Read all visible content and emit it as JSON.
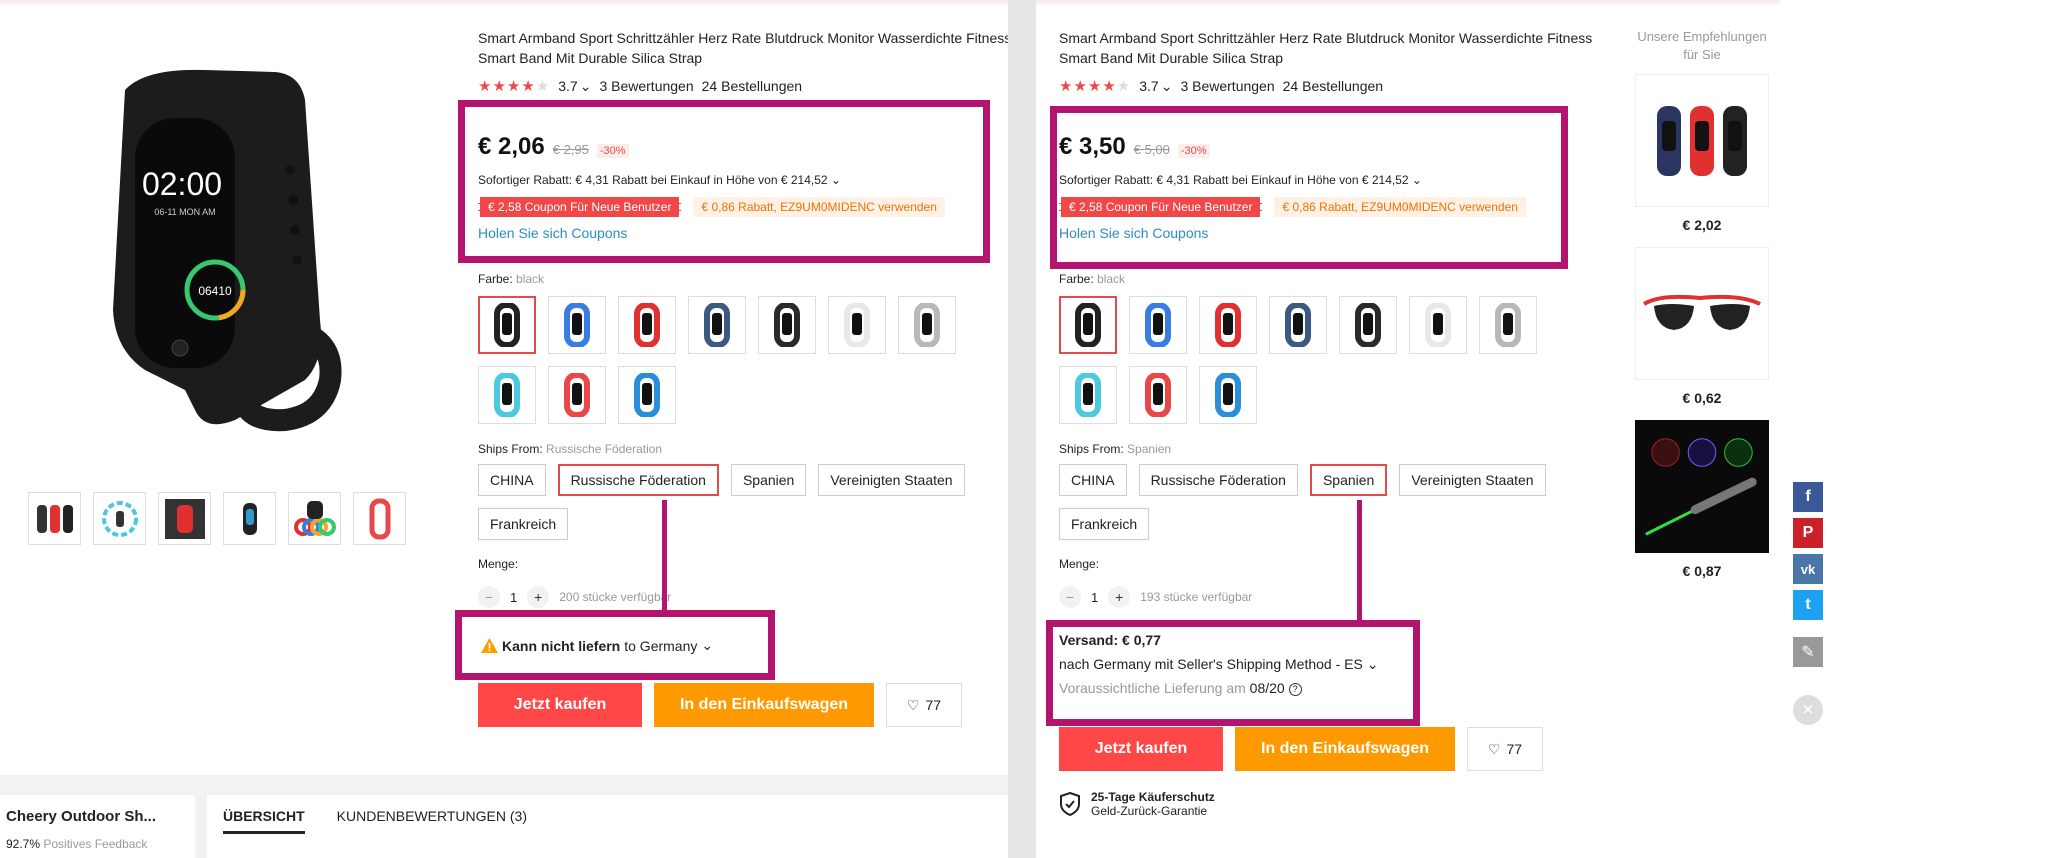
{
  "product": {
    "title": "Smart Armband Sport Schrittzähler Herz Rate Blutdruck Monitor Wasserdichte Fitness Smart Band Mit Durable Silica Strap",
    "rating": "3.7",
    "rating_stars": 3.7,
    "reviews": "3 Bewertungen",
    "orders": "24 Bestellungen",
    "watch_time": "02:00",
    "watch_date": "06-11 MON AM",
    "watch_steps": "06410"
  },
  "left": {
    "price": "€ 2,06",
    "price_old": "€ 2,95",
    "discount": "-30%",
    "rebate": "Sofortiger Rabatt: € 4,31 Rabatt bei Einkauf in Höhe von € 214,52",
    "coupon_new": "€ 2,58 Coupon Für Neue Benutzer",
    "coupon_code": "€ 0,86 Rabatt, EZ9UM0MIDENC verwenden",
    "get_coupons": "Holen Sie sich Coupons",
    "color_label": "Farbe:",
    "color_value": "black",
    "ships_label": "Ships From:",
    "ships_value": "Russische Föderation",
    "ship_options": [
      "CHINA",
      "Russische Föderation",
      "Spanien",
      "Vereinigten Staaten",
      "Frankreich"
    ],
    "qty_label": "Menge:",
    "qty_value": "1",
    "qty_avail": "200 stücke verfügbar",
    "ship_warn_bold": "Kann nicht liefern",
    "ship_warn_rest": "to Germany",
    "buy": "Jetzt kaufen",
    "cart": "In den Einkaufswagen",
    "wish_count": "77"
  },
  "right": {
    "price": "€ 3,50",
    "price_old": "€ 5,00",
    "discount": "-30%",
    "rebate": "Sofortiger Rabatt: € 4,31 Rabatt bei Einkauf in Höhe von € 214,52",
    "coupon_new": "€ 2,58 Coupon Für Neue Benutzer",
    "coupon_code": "€ 0,86 Rabatt, EZ9UM0MIDENC verwenden",
    "get_coupons": "Holen Sie sich Coupons",
    "color_label": "Farbe:",
    "color_value": "black",
    "ships_label": "Ships From:",
    "ships_value": "Spanien",
    "ship_options": [
      "CHINA",
      "Russische Föderation",
      "Spanien",
      "Vereinigten Staaten",
      "Frankreich"
    ],
    "qty_label": "Menge:",
    "qty_value": "1",
    "qty_avail": "193 stücke verfügbar",
    "shipping_cost": "Versand: € 0,77",
    "shipping_method": "nach Germany mit Seller's Shipping Method - ES",
    "delivery_label": "Voraussichtliche Lieferung am",
    "delivery_date": "08/20",
    "buy": "Jetzt kaufen",
    "cart": "In den Einkaufswagen",
    "wish_count": "77",
    "protect_title": "25-Tage Käuferschutz",
    "protect_sub": "Geld-Zurück-Garantie"
  },
  "swatch_colors": [
    "#222222",
    "#3a7de0",
    "#e03030",
    "#3c5a80",
    "#2a2a2a",
    "#e8e8e8",
    "#b8b8b8",
    "#4cc8e0",
    "#e84848",
    "#2b8ed8"
  ],
  "store": {
    "name": "Cheery Outdoor Sh...",
    "feedback_pct": "92.7%",
    "feedback_label": "Positives Feedback"
  },
  "tabs": [
    "ÜBERSICHT",
    "KUNDENBEWERTUNGEN (3)"
  ],
  "recommend": {
    "title": "Unsere Empfehlungen für Sie",
    "items": [
      {
        "price": "€ 2,02",
        "icon": "fitness-bands-image"
      },
      {
        "price": "€ 0,62",
        "icon": "sunglasses-image"
      },
      {
        "price": "€ 0,87",
        "icon": "laser-pointer-image"
      }
    ]
  },
  "social": {
    "facebook": "f",
    "pinterest": "P",
    "vk": "vk",
    "twitter": "t"
  },
  "colors": {
    "accent_red": "#ff4747",
    "accent_orange": "#ff9900",
    "highlight_box": "#b3146e",
    "link_blue": "#2a8fbd"
  }
}
